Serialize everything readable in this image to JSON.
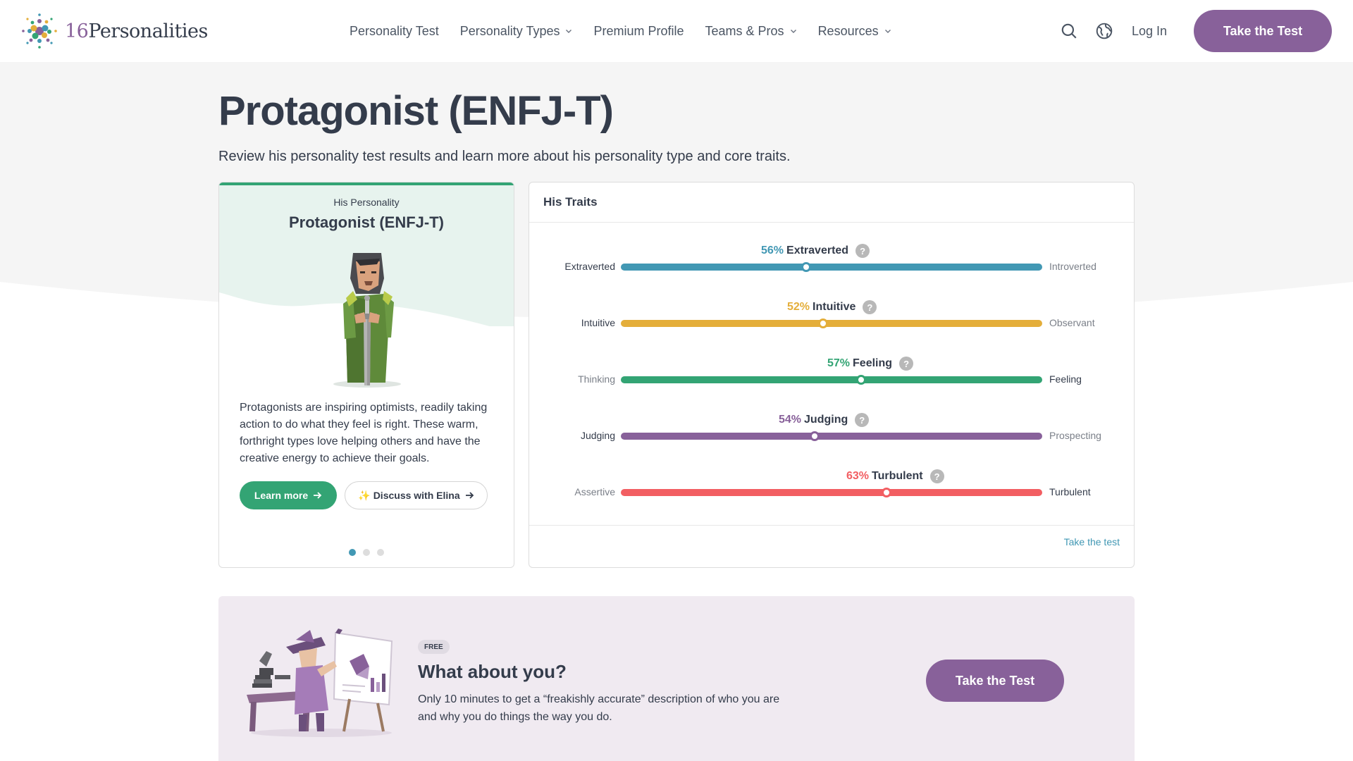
{
  "header": {
    "logo_number": "16",
    "logo_word": "Personalities",
    "nav": [
      {
        "label": "Personality Test",
        "dropdown": false
      },
      {
        "label": "Personality Types",
        "dropdown": true
      },
      {
        "label": "Premium Profile",
        "dropdown": false
      },
      {
        "label": "Teams & Pros",
        "dropdown": true
      },
      {
        "label": "Resources",
        "dropdown": true
      }
    ],
    "icons": [
      "search-icon",
      "globe-icon"
    ],
    "login_label": "Log In",
    "cta_label": "Take the Test"
  },
  "page": {
    "title": "Protagonist (ENFJ-T)",
    "subtitle": "Review his personality test results and learn more about his personality type and core traits."
  },
  "personality_card": {
    "label": "His Personality",
    "title": "Protagonist (ENFJ-T)",
    "description": "Protagonists are inspiring optimists, readily taking action to do what they feel is right. These warm, forthright types love helping others and have the creative energy to achieve their goals.",
    "learn_more_label": "Learn more",
    "discuss_label": "✨ Discuss with Elina",
    "carousel": {
      "total": 3,
      "active": 1
    },
    "accent_color": "#33a474"
  },
  "traits_card": {
    "title": "His Traits",
    "footer_link": "Take the test",
    "traits": [
      {
        "percent": "56%",
        "trait": "Extraverted",
        "left": "Extraverted",
        "right": "Introverted",
        "left_active": true,
        "fraction_from_left": 0.44,
        "color": "#4298b4"
      },
      {
        "percent": "52%",
        "trait": "Intuitive",
        "left": "Intuitive",
        "right": "Observant",
        "left_active": true,
        "fraction_from_left": 0.48,
        "color": "#e4ae3a"
      },
      {
        "percent": "57%",
        "trait": "Feeling",
        "left": "Thinking",
        "right": "Feeling",
        "left_active": false,
        "fraction_from_left": 0.57,
        "color": "#33a474"
      },
      {
        "percent": "54%",
        "trait": "Judging",
        "left": "Judging",
        "right": "Prospecting",
        "left_active": true,
        "fraction_from_left": 0.46,
        "color": "#88619a"
      },
      {
        "percent": "63%",
        "trait": "Turbulent",
        "left": "Assertive",
        "right": "Turbulent",
        "left_active": false,
        "fraction_from_left": 0.63,
        "color": "#f25e62"
      }
    ]
  },
  "cta": {
    "badge": "FREE",
    "title": "What about you?",
    "description": "Only 10 minutes to get a “freakishly accurate” description of who you are and why you do things the way you do.",
    "button_label": "Take the Test"
  }
}
